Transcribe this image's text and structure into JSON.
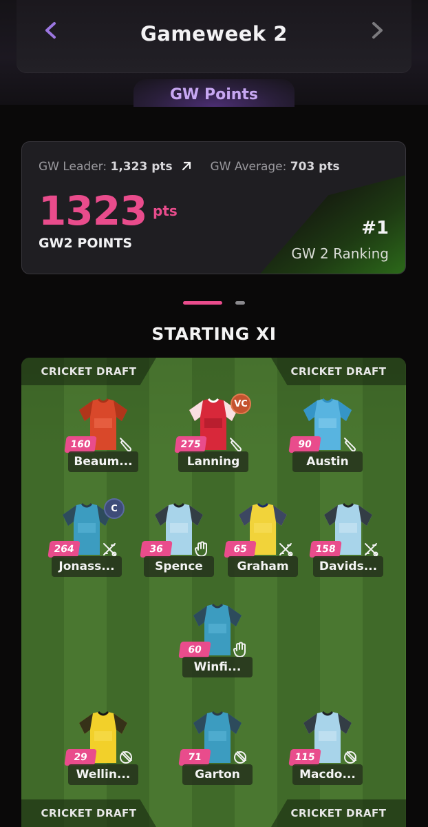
{
  "header": {
    "title": "Gameweek 2",
    "tab_label": "GW Points"
  },
  "summary": {
    "leader_label": "GW Leader:",
    "leader_value": "1,323 pts",
    "average_label": "GW Average:",
    "average_value": "703 pts",
    "points": "1323",
    "points_unit": "pts",
    "points_label": "GW2 POINTS",
    "rank": "#1",
    "rank_label": "GW 2 Ranking"
  },
  "section_title": "STARTING XI",
  "pitch": {
    "banner_text": "CRICKET DRAFT"
  },
  "players": [
    {
      "name": "Beaum...",
      "points": "160",
      "role": "batter",
      "badge": "",
      "shirt": "orange"
    },
    {
      "name": "Lanning",
      "points": "275",
      "role": "batter",
      "badge": "VC",
      "shirt": "red"
    },
    {
      "name": "Austin",
      "points": "90",
      "role": "batter",
      "badge": "",
      "shirt": "skyblue"
    },
    {
      "name": "Jonass...",
      "points": "264",
      "role": "allrounder",
      "badge": "C",
      "shirt": "teal"
    },
    {
      "name": "Spence",
      "points": "36",
      "role": "keeper",
      "badge": "",
      "shirt": "lightblue"
    },
    {
      "name": "Graham",
      "points": "65",
      "role": "allrounder",
      "badge": "",
      "shirt": "yellow"
    },
    {
      "name": "Davids...",
      "points": "158",
      "role": "allrounder",
      "badge": "",
      "shirt": "lightblue"
    },
    {
      "name": "Winfi...",
      "points": "60",
      "role": "keeper",
      "badge": "",
      "shirt": "teal"
    },
    {
      "name": "Wellin...",
      "points": "29",
      "role": "bowler",
      "badge": "",
      "shirt": "yellowblack"
    },
    {
      "name": "Garton",
      "points": "71",
      "role": "bowler",
      "badge": "",
      "shirt": "teal"
    },
    {
      "name": "Macdo...",
      "points": "115",
      "role": "bowler",
      "badge": "",
      "shirt": "lightblue"
    }
  ],
  "colors": {
    "accent_pink": "#e94c8c",
    "accent_purple": "#c7a7f2",
    "pitch_green": "#406a29"
  }
}
